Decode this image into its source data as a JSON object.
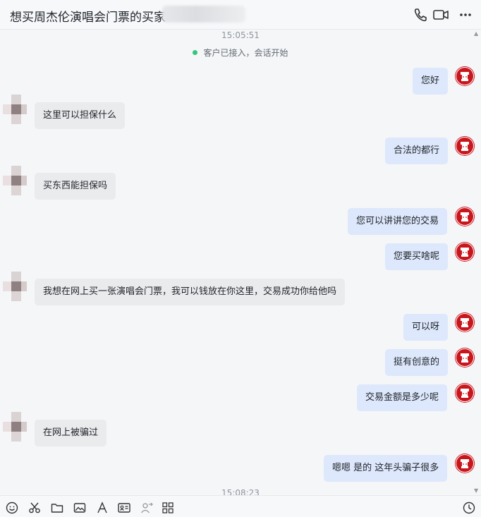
{
  "header": {
    "title": "想买周杰伦演唱会门票的买家",
    "icons": [
      "phone-icon",
      "video-call-icon",
      "more-icon"
    ]
  },
  "chat": {
    "timestamp_top": "15:05:51",
    "system_message": "客户已接入，会话开始",
    "messages": [
      {
        "side": "out",
        "text": "您好"
      },
      {
        "side": "in",
        "text": "这里可以担保什么"
      },
      {
        "side": "out",
        "text": "合法的都行"
      },
      {
        "side": "in",
        "text": "买东西能担保吗"
      },
      {
        "side": "out",
        "text": "您可以讲讲您的交易"
      },
      {
        "side": "out",
        "text": "您要买啥呢"
      },
      {
        "side": "in",
        "text": "我想在网上买一张演唱会门票，我可以钱放在你这里，交易成功你给他吗"
      },
      {
        "side": "out",
        "text": "可以呀"
      },
      {
        "side": "out",
        "text": "挺有创意的"
      },
      {
        "side": "out",
        "text": "交易金额是多少呢"
      },
      {
        "side": "in",
        "text": "在网上被骗过"
      },
      {
        "side": "out",
        "text": "嗯嗯 是的 这年头骗子很多"
      }
    ],
    "timestamp_bottom": "15:08:23"
  },
  "composer": {
    "tools": [
      "emoji-icon",
      "scissors-icon",
      "folder-icon",
      "image-icon",
      "font-icon",
      "contact-card-icon",
      "transfer-user-icon",
      "apps-grid-icon",
      "history-icon"
    ]
  },
  "colors": {
    "bubble_in": "#eaebed",
    "bubble_out": "#dde8fc",
    "avatar_red": "#c8161d",
    "online_dot": "#34c77b"
  }
}
